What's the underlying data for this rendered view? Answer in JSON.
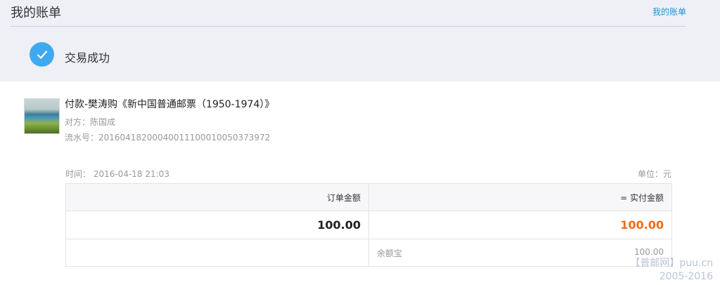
{
  "header": {
    "title": "我的账单",
    "link_label": "我的账单"
  },
  "status": {
    "text": "交易成功",
    "icon": "check-icon"
  },
  "transaction": {
    "title": "付款-樊涛购《新中国普通邮票（1950-1974）》",
    "counterparty": "对方：陈国成",
    "serial": "流水号：20160418200040011100010050373972"
  },
  "details": {
    "time": "时间： 2016-04-18 21:03",
    "unit": "单位：元"
  },
  "amounts": {
    "order_header": "订单金额",
    "paid_header": "= 实付金额",
    "order_value": "100.00",
    "paid_value": "100.00",
    "method_label": "余额宝",
    "method_value": "100.00"
  },
  "watermark": {
    "line1": "【普邮网】puu.cn",
    "line2": "2005-2016"
  },
  "colors": {
    "accent": "#1a98d5",
    "check": "#3fa9f0",
    "paid": "#ef6c15"
  }
}
